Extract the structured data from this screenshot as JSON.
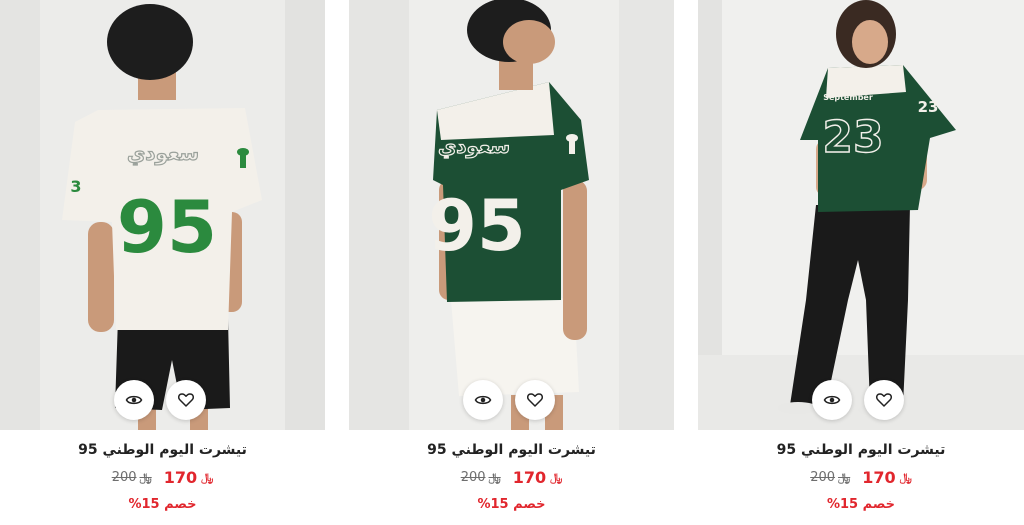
{
  "colors": {
    "accent_red": "#e1262d",
    "jersey_green": "#1f6b3a",
    "jersey_dark_green": "#1c4f34",
    "jersey_white": "#f3f0ea"
  },
  "icons": {
    "view": "eye-icon",
    "wishlist": "heart-icon",
    "currency": "riyal-symbol-icon"
  },
  "products": [
    {
      "title": "تيشرت اليوم الوطني 95",
      "price_new": "170",
      "price_old": "200",
      "currency_symbol": "﷼",
      "discount": "خصم 15%",
      "jersey_word": "سعودي",
      "jersey_number": "95",
      "sleeve_number": "3"
    },
    {
      "title": "تيشرت اليوم الوطني 95",
      "price_new": "170",
      "price_old": "200",
      "currency_symbol": "﷼",
      "discount": "خصم 15%",
      "jersey_word": "سعودي",
      "jersey_number": "95"
    },
    {
      "title": "تيشرت اليوم الوطني 95",
      "price_new": "170",
      "price_old": "200",
      "currency_symbol": "﷼",
      "discount": "خصم 15%",
      "jersey_word": "September",
      "jersey_number": "23",
      "sleeve_number": "23"
    }
  ]
}
